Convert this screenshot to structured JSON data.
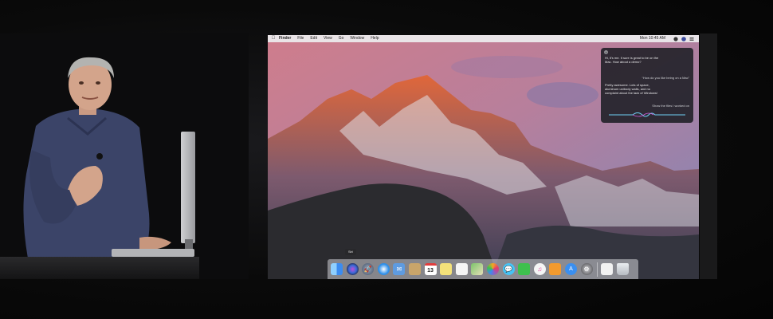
{
  "menubar": {
    "items": [
      "Finder",
      "File",
      "Edit",
      "View",
      "Go",
      "Window",
      "Help"
    ],
    "clock": "Mon 10:45 AM",
    "icons": [
      "apple-icon",
      "siri-icon",
      "user-icon",
      "menu-list-icon"
    ]
  },
  "siri": {
    "message1": "Hi, it's me. It sure is great to be on the Mac. How about a demo?",
    "user1": "“How do you like being on a Mac”",
    "message2": "Pretty awesome. Lots of space, aluminum unibody walls, and no complaint about the lack of Windows!",
    "user2": "Show the files I worked on"
  },
  "dock": {
    "tooltip": "Siri",
    "apps": [
      {
        "name": "finder",
        "color": "#3c8cf0"
      },
      {
        "name": "siri",
        "color": "#2a2f5a"
      },
      {
        "name": "launchpad",
        "color": "#6c7d93"
      },
      {
        "name": "safari",
        "color": "#2d8ee8"
      },
      {
        "name": "mail",
        "color": "#5e9be0"
      },
      {
        "name": "contacts",
        "color": "#c9a56a"
      },
      {
        "name": "calendar",
        "color": "#ffffff"
      },
      {
        "name": "notes",
        "color": "#f4e27a"
      },
      {
        "name": "reminders",
        "color": "#f5f5f5"
      },
      {
        "name": "maps",
        "color": "#7cc46b"
      },
      {
        "name": "photos",
        "color": "#f2f2f2"
      },
      {
        "name": "messages",
        "color": "#46c3f5"
      },
      {
        "name": "facetime",
        "color": "#3ec04e"
      },
      {
        "name": "itunes",
        "color": "#f5f5f5"
      },
      {
        "name": "ibooks",
        "color": "#f29a2e"
      },
      {
        "name": "app-store",
        "color": "#3a8ff0"
      },
      {
        "name": "system-preferences",
        "color": "#7a7a7e"
      },
      {
        "name": "preview",
        "color": "#f2f2f2"
      },
      {
        "name": "trash",
        "color": "#cfd3d8"
      }
    ],
    "calendar_day": "13"
  }
}
